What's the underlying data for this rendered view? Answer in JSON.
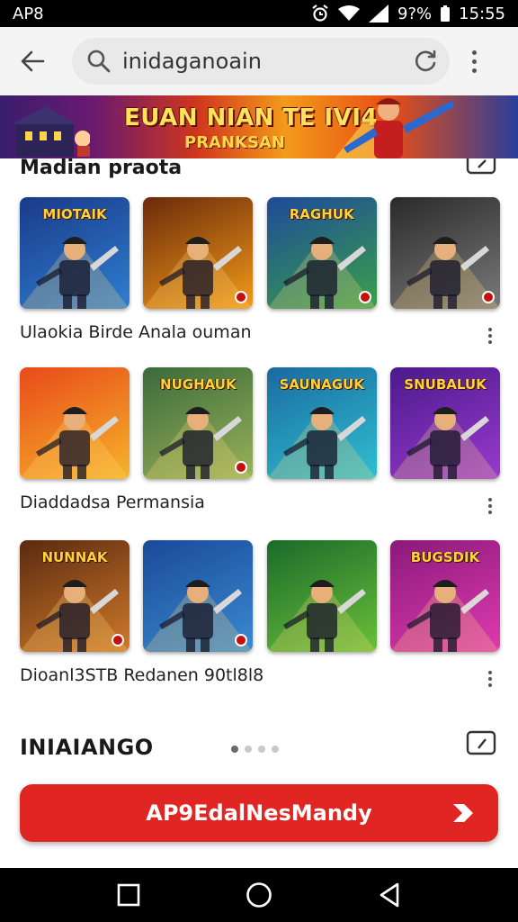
{
  "status_bar": {
    "carrier": "AP8",
    "battery": "9?%",
    "time": "15:55"
  },
  "search": {
    "value": "inidaganoain",
    "placeholder": ""
  },
  "banner": {
    "title": "EUAN NIAN TE IVI4",
    "subtitle": "PRANKSAN"
  },
  "section": {
    "title": "Madian praota"
  },
  "rows": [
    {
      "caption": "Ulaokia Birde Anala ouman",
      "tiles": [
        {
          "title": "MIOTAIK",
          "colors": [
            "#1a3a8a",
            "#2f7fd0"
          ],
          "badge": false
        },
        {
          "title": "",
          "colors": [
            "#6a2a0a",
            "#f39a1a"
          ],
          "badge": true
        },
        {
          "title": "RAGHUK",
          "colors": [
            "#1e4a9a",
            "#3aa04a"
          ],
          "badge": true
        },
        {
          "title": "",
          "colors": [
            "#2a2a2a",
            "#7a7a7a"
          ],
          "badge": true
        }
      ]
    },
    {
      "caption": "Diaddadsa Permansia",
      "tiles": [
        {
          "title": "",
          "colors": [
            "#e84a1a",
            "#f6b42a"
          ],
          "badge": false
        },
        {
          "title": "NUGHAUK",
          "colors": [
            "#3a6a3a",
            "#9ab25a"
          ],
          "badge": true
        },
        {
          "title": "SAUNAGUK",
          "colors": [
            "#1a6aa0",
            "#2fc0d0"
          ],
          "badge": false
        },
        {
          "title": "SNUBALUK",
          "colors": [
            "#4a1a8a",
            "#9a3ad0"
          ],
          "badge": false
        }
      ]
    },
    {
      "caption": "Dioanl3STB Redanen 90tl8l8",
      "tiles": [
        {
          "title": "NUNNAK",
          "colors": [
            "#5a2a10",
            "#d07a2a"
          ],
          "badge": true
        },
        {
          "title": "",
          "colors": [
            "#1a4a9a",
            "#3a8ad0"
          ],
          "badge": true
        },
        {
          "title": "",
          "colors": [
            "#1a6a2a",
            "#6ac03a"
          ],
          "badge": false
        },
        {
          "title": "BUGSDIK",
          "colors": [
            "#8a1a7a",
            "#e03ab0"
          ],
          "badge": false
        }
      ]
    }
  ],
  "footer": {
    "label": "INIAIANGO",
    "pager": {
      "count": 4,
      "active": 0
    }
  },
  "cta": {
    "label": "AP9EdalNesMandy"
  },
  "colors": {
    "cta": "#e12523",
    "status_bar": "#000000",
    "header": "#f4f4f4"
  },
  "icons": {
    "status": [
      "alarm-icon",
      "wifi-icon",
      "signal-icon"
    ],
    "header": [
      "back-arrow-icon",
      "search-icon",
      "refresh-icon",
      "more-vert-icon"
    ],
    "nav": [
      "recent-apps-icon",
      "home-icon",
      "back-icon"
    ]
  }
}
